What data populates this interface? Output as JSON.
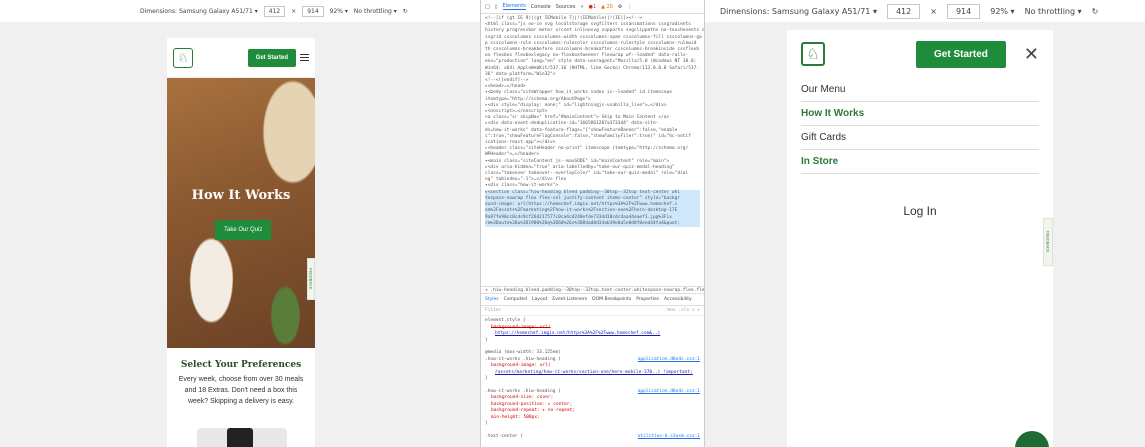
{
  "toolbar_left": {
    "dimensions": "Dimensions: Samsung Galaxy A51/71 ▾",
    "width": "412",
    "x": "×",
    "height": "914",
    "zoom": "92% ▾",
    "throttle": "No throttling ▾"
  },
  "toolbar_right": {
    "dimensions": "Dimensions: Samsung Galaxy A51/71 ▾",
    "width": "412",
    "x": "×",
    "height": "914",
    "zoom": "92% ▾",
    "throttle": "No throttling ▾"
  },
  "left_phone": {
    "get_started": "Get Started",
    "hero_title": "How It Works",
    "quiz_button": "Take Our Quiz",
    "feedback": "FEEDBACK",
    "pref_title": "Select Your Preferences",
    "pref_text": "Every week, choose from over 30 meals and 18 Extras. Don't need a box this week? Skipping a delivery is easy."
  },
  "devtools": {
    "tabs": [
      "Elements",
      "Console",
      "Sources",
      "»"
    ],
    "error_count": "●1",
    "warn_count": "▲ 20",
    "code_lines": [
      "<!--[if (gt IE 9)|(gt IEMobile 7)|!(IEMobile)|!(IE)]><!-->",
      "<html class=\"js no-ie svg localstorage svgfilters cssanimations cssgradients",
      "history progressbar meter srcset inlinesvg supports svgclippaths no-touchevents c",
      "ssgrid csscolumns csscolumns-width csscolumns-span csscolumns-fill csscolumns-ga",
      "p csscolumns-rule csscolumns-rulecolor csscolumns-rulestyle csscolumns-rulewid",
      "th csscolumns-breakbefore csscolumns-breakafter csscolumns-breakinside cssflexb",
      "ox flexbox flexboxlegacy no-flexboxtweener flexwrap wf--loaded\" data-rails-",
      "env=\"production\" lang=\"en\" style data-useragent=\"Mozilla/5.0 (Windows NT 10.0;",
      "Win64; x64) AppleWebKit/537.36 (KHTML, like Gecko) Chrome/113.0.0.0 Safari/537.",
      "36\" data-platform=\"Win32\">",
      "  <!--<![endif]-->",
      "  ▸<head>…</head>",
      "  ▾<body class=\"siteWrapper how_it_works index is--loaded\" id itemscope",
      "  itemtype=\"http://schema.org/AboutPage\">",
      "    ▸<div style=\"display: none;\" id=\"lightningjs-usabilla_live\">…</div>",
      "    ▸<noscript>…</noscript>",
      "    <a class=\"sr skipNav\" href=\"#mainContent\"> Skip to Main Content </a>",
      "    ▸<div data-event-deduplication-id=\"1665861207a3733d4\" data-site-",
      "    ds=how-it-works\" data-feature-flags=\"{\"showFeatureBanner\":false,\"enable",
      "    c\":true,\"showFeatureFlagConsole\":false,\"showFamilyFiler\":true}\" id=\"hc-notif",
      "    ications-react-app\"></div>",
      "    ▸<header class=\"siteHeader no-print\" itemscope itemtype=\"http://schema.org/",
      "    WPHeader\">…</header>",
      "    ▾<main class=\"siteContent js--maxSODE\" id=\"mainContent\" role=\"main\">",
      "      ▸<div aria-hidden=\"true\" aria-labelledby=\"take-our-quiz-modal-heading\"",
      "      class=\"takeover takeover--overlayColor\" id=\"take-our-quiz-modal\" role=\"dial",
      "      og\" tabindex=\"-1\">…</div> flex",
      "      ▾<div class=\"how-it-works\">",
      "        ▸<section class=\"hiw-heading bleed padding--30top--32top text-center whi",
      "        tespace-nowrap flex flex-col justify-content items-center\" style=\"backgr",
      "        ound-image: url(https://homechef.imgix.net/https%3A%2F%2Fwww.homechef.c",
      "        om%2Fassets%2Fmarketing%2Fhow-it-works%2Fsection-one%2Fhero-desktop-17E",
      "        9a97fe90cc0cdc9cf26d217577c0ca4cd248efde7334d18cdc4aa44eaef1.jpg%3Fix",
      "        rm%3Dauto%26w%3D1980%26q%3D60%26s%3D8dad8d34ab39e0a5e8d8f0eed44fa4&quot;"
    ],
    "selected_line": 28,
    "breadcrumb": "◂ .hiw-heading.bleed.padding--30top--32top.text-center.whitespace-nowrap.flex.flex-col.justify-content.ite",
    "style_tabs": [
      "Styles",
      "Computed",
      "Layout",
      "Event Listeners",
      "DOM Breakpoints",
      "Properties",
      "Accessibility"
    ],
    "filter": "Filter",
    "filter_right": ":hov .cls + ✦",
    "element_style": "element.style {",
    "bg_strike": "background-image: url(",
    "bg_url": "https://homechef.imgix.net/https%3A%2F%2Fwww.homechef.com&..)",
    "media": "@media (max-width: 33.125em)",
    "rule1_sel": ".how-it-works .hiw-heading {",
    "rule1_file": "application.d6e4c.css:1",
    "rule1_prop": "background-image: url(",
    "rule1_val": "/assets/marketing/how-it-works/section-one/hero-mobile-370..) !important;",
    "rule2_sel": ".how-it-works .hiw-heading {",
    "rule2_file": "application.d6e4c.css:1",
    "rule2_props": [
      "background-size: cover;",
      "background-position: ▸ center;",
      "background-repeat: ▸ no-repeat;",
      "min-height: 500px;"
    ],
    "rule3_sel": ".text-center {",
    "rule3_file": "utilities-b.c3usm.css:1"
  },
  "right_phone": {
    "get_started": "Get Started",
    "close": "✕",
    "menu": [
      "Our Menu",
      "How It Works",
      "Gift Cards",
      "In Store"
    ],
    "login": "Log In",
    "feedback": "FEEDBACK"
  }
}
